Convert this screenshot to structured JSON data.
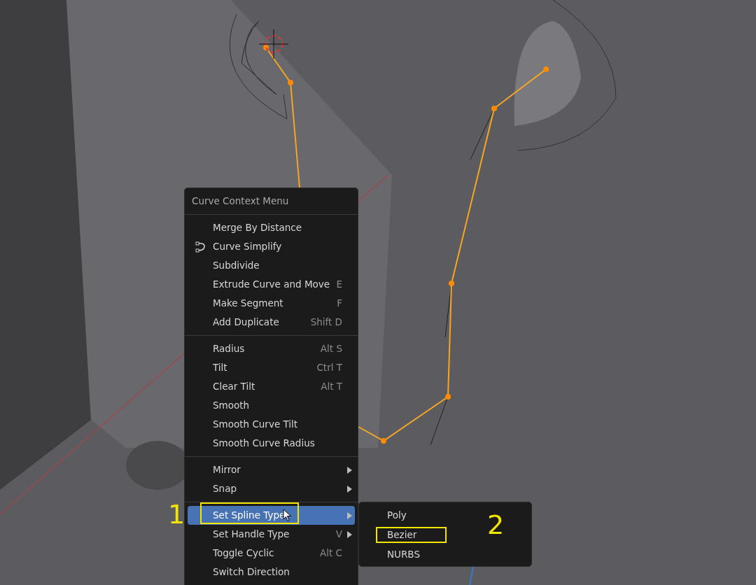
{
  "menu": {
    "title": "Curve Context Menu",
    "groups": [
      [
        {
          "label": "Merge By Distance",
          "submenu": false,
          "icon": false,
          "selected": false
        },
        {
          "label": "Curve Simplify",
          "submenu": false,
          "icon": true,
          "selected": false
        },
        {
          "label": "Subdivide",
          "submenu": false,
          "icon": false,
          "selected": false
        },
        {
          "label": "Extrude Curve and Move",
          "shortcut": "E",
          "submenu": false,
          "icon": false,
          "selected": false
        },
        {
          "label": "Make Segment",
          "shortcut": "F",
          "submenu": false,
          "icon": false,
          "selected": false
        },
        {
          "label": "Add Duplicate",
          "shortcut": "Shift D",
          "submenu": false,
          "icon": false,
          "selected": false
        }
      ],
      [
        {
          "label": "Radius",
          "shortcut": "Alt S",
          "submenu": false,
          "icon": false,
          "selected": false
        },
        {
          "label": "Tilt",
          "shortcut": "Ctrl T",
          "submenu": false,
          "icon": false,
          "selected": false
        },
        {
          "label": "Clear Tilt",
          "shortcut": "Alt T",
          "submenu": false,
          "icon": false,
          "selected": false
        },
        {
          "label": "Smooth",
          "submenu": false,
          "icon": false,
          "selected": false
        },
        {
          "label": "Smooth Curve Tilt",
          "submenu": false,
          "icon": false,
          "selected": false
        },
        {
          "label": "Smooth Curve Radius",
          "submenu": false,
          "icon": false,
          "selected": false
        }
      ],
      [
        {
          "label": "Mirror",
          "submenu": true,
          "icon": false,
          "selected": false
        },
        {
          "label": "Snap",
          "submenu": true,
          "icon": false,
          "selected": false
        }
      ],
      [
        {
          "label": "Set Spline Type",
          "submenu": true,
          "icon": false,
          "selected": true
        },
        {
          "label": "Set Handle Type",
          "shortcut": "V",
          "submenu": true,
          "icon": false,
          "selected": false
        },
        {
          "label": "Toggle Cyclic",
          "shortcut": "Alt C",
          "submenu": false,
          "icon": false,
          "selected": false
        },
        {
          "label": "Switch Direction",
          "submenu": false,
          "icon": false,
          "selected": false
        }
      ]
    ]
  },
  "submenu": {
    "items": [
      {
        "label": "Poly",
        "selected": false
      },
      {
        "label": "Bezier",
        "selected": false
      },
      {
        "label": "NURBS",
        "selected": false
      }
    ]
  },
  "annotations": [
    {
      "label": "1"
    },
    {
      "label": "2"
    }
  ]
}
